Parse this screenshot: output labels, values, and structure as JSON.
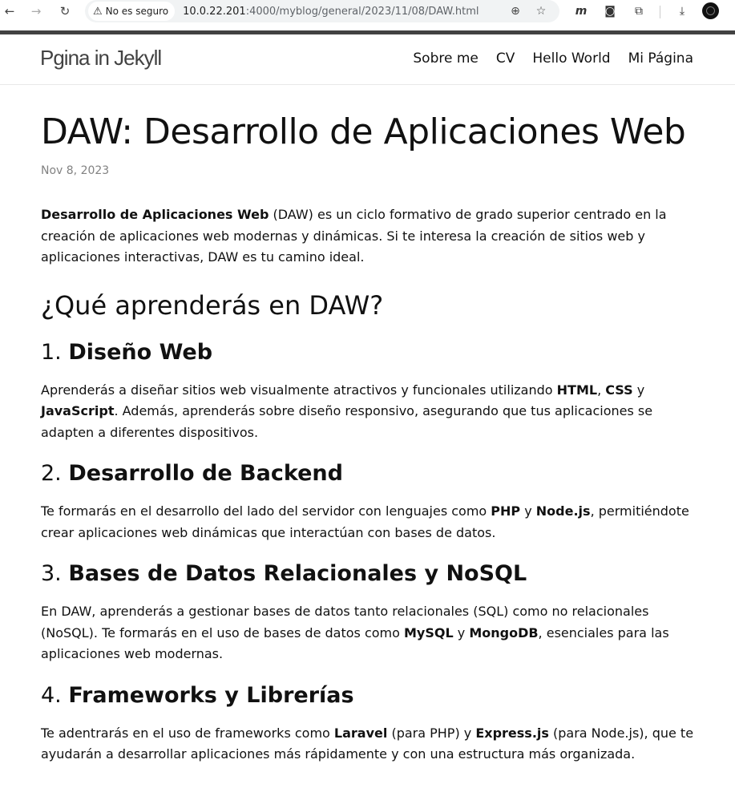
{
  "browser": {
    "security_label": "No es seguro",
    "url_host": "10.0.22.201",
    "url_path": ":4000/myblog/general/2023/11/08/DAW.html",
    "back_icon": "arrow-left-icon",
    "forward_icon": "arrow-right-icon",
    "reload_icon": "reload-icon",
    "ext_m_label": "m"
  },
  "site": {
    "title": "Pgina in Jekyll",
    "nav": [
      "Sobre me",
      "CV",
      "Hello World",
      "Mi Página"
    ]
  },
  "post": {
    "title": "DAW: Desarrollo de Aplicaciones Web",
    "date": "Nov 8, 2023",
    "intro_bold": "Desarrollo de Aplicaciones Web",
    "intro_rest": " (DAW) es un ciclo formativo de grado superior centrado en la creación de aplicaciones web modernas y dinámicas. Si te interesa la creación de sitios web y aplicaciones interactivas, DAW es tu camino ideal.",
    "section_heading": "¿Qué aprenderás en DAW?",
    "sections": [
      {
        "num": "1. ",
        "title": "Diseño Web",
        "parts": [
          {
            "t": "Aprenderás a diseñar sitios web visualmente atractivos y funcionales utilizando "
          },
          {
            "t": "HTML",
            "b": true
          },
          {
            "t": ", "
          },
          {
            "t": "CSS",
            "b": true
          },
          {
            "t": " y "
          },
          {
            "t": "JavaScript",
            "b": true
          },
          {
            "t": ". Además, aprenderás sobre diseño responsivo, asegurando que tus aplicaciones se adapten a diferentes dispositivos."
          }
        ]
      },
      {
        "num": "2. ",
        "title": "Desarrollo de Backend",
        "parts": [
          {
            "t": "Te formarás en el desarrollo del lado del servidor con lenguajes como "
          },
          {
            "t": "PHP",
            "b": true
          },
          {
            "t": " y "
          },
          {
            "t": "Node.js",
            "b": true
          },
          {
            "t": ", permitiéndote crear aplicaciones web dinámicas que interactúan con bases de datos."
          }
        ]
      },
      {
        "num": "3. ",
        "title": "Bases de Datos Relacionales y NoSQL",
        "parts": [
          {
            "t": "En DAW, aprenderás a gestionar bases de datos tanto relacionales (SQL) como no relacionales (NoSQL). Te formarás en el uso de bases de datos como "
          },
          {
            "t": "MySQL",
            "b": true
          },
          {
            "t": " y "
          },
          {
            "t": "MongoDB",
            "b": true
          },
          {
            "t": ", esenciales para las aplicaciones web modernas."
          }
        ]
      },
      {
        "num": "4. ",
        "title": "Frameworks y Librerías",
        "parts": [
          {
            "t": "Te adentrarás en el uso de frameworks como "
          },
          {
            "t": "Laravel",
            "b": true
          },
          {
            "t": " (para PHP) y "
          },
          {
            "t": "Express.js",
            "b": true
          },
          {
            "t": " (para Node.js), que te ayudarán a desarrollar aplicaciones más rápidamente y con una estructura más organizada."
          }
        ]
      }
    ]
  }
}
